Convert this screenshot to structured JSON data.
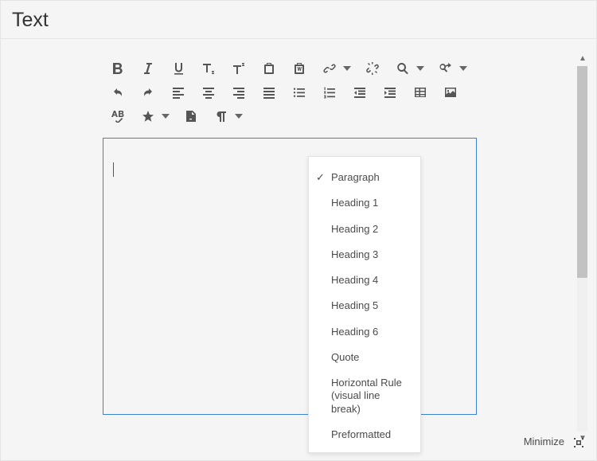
{
  "header": {
    "title": "Text"
  },
  "toolbar": {
    "icons": [
      "bold",
      "italic",
      "underline",
      "subscript",
      "superscript",
      "paste",
      "paste-word",
      "link",
      "unlink",
      "find",
      "replace",
      "undo",
      "redo",
      "align-left",
      "align-center",
      "align-right",
      "align-justify",
      "bullet-list",
      "numbered-list",
      "outdent",
      "indent",
      "table",
      "image",
      "spellcheck",
      "special-char",
      "source-edit",
      "paragraph-format"
    ]
  },
  "format_menu": {
    "items": [
      {
        "label": "Paragraph",
        "selected": true
      },
      {
        "label": "Heading 1"
      },
      {
        "label": "Heading 2"
      },
      {
        "label": "Heading 3"
      },
      {
        "label": "Heading 4"
      },
      {
        "label": "Heading 5"
      },
      {
        "label": "Heading 6"
      },
      {
        "label": "Quote"
      },
      {
        "label": "Horizontal Rule (vis­ual line break)"
      },
      {
        "label": "Preformatted"
      }
    ]
  },
  "footer": {
    "minimize_label": "Minimize"
  }
}
